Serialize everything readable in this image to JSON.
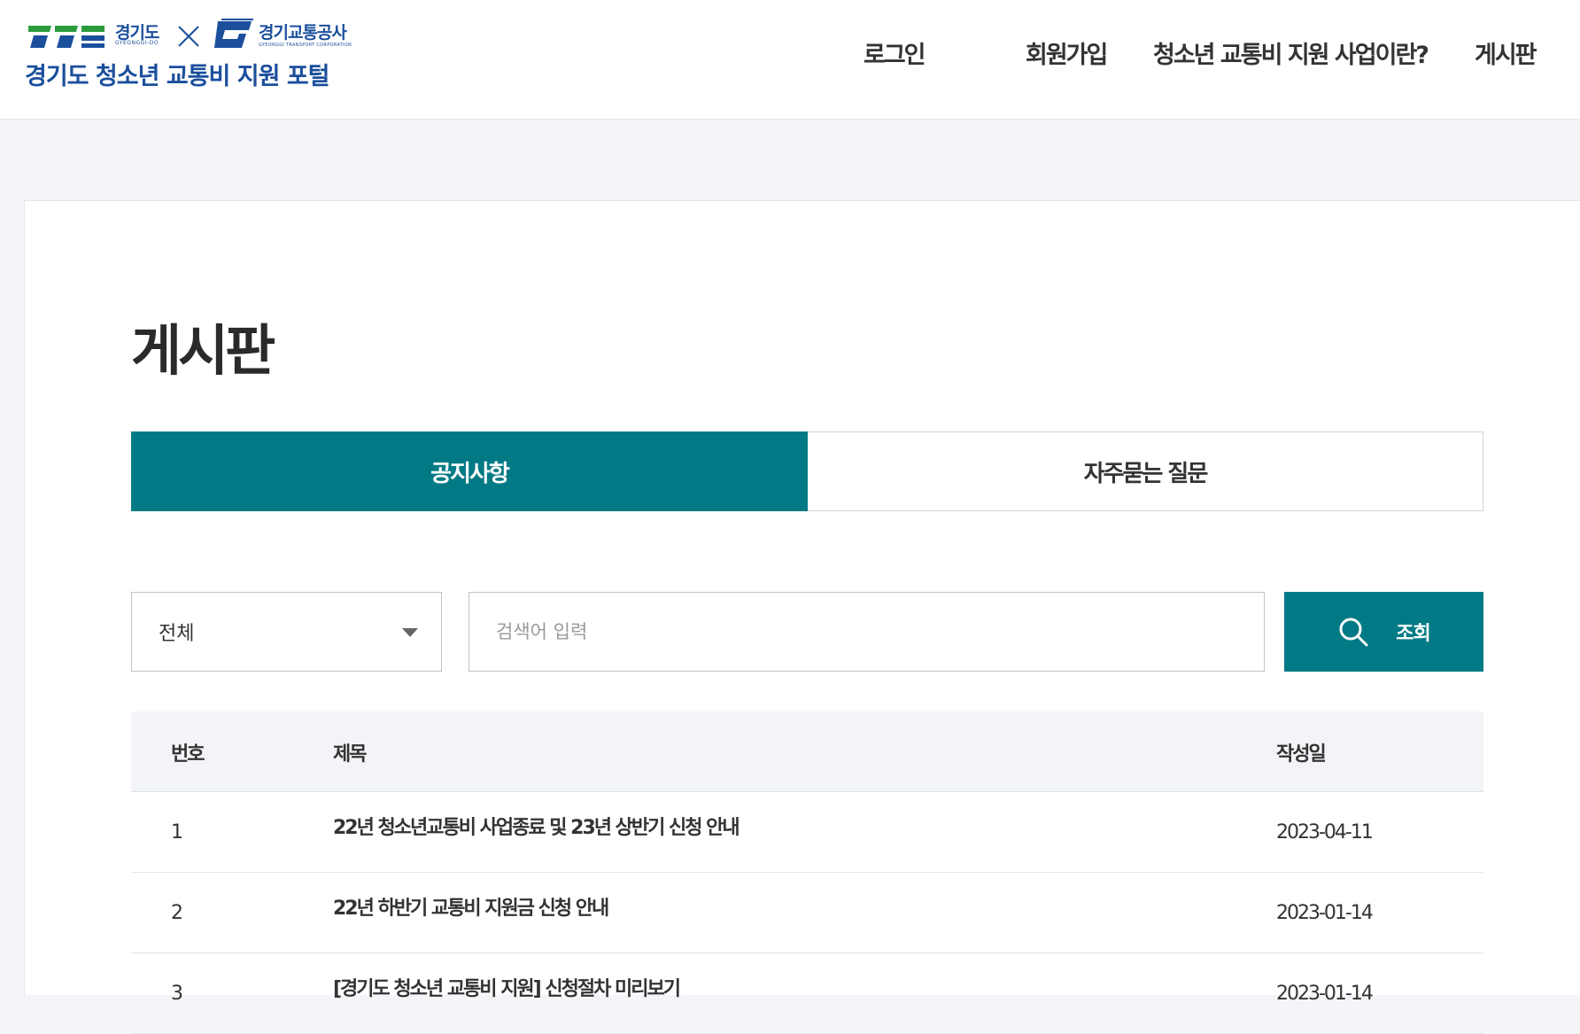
{
  "header": {
    "logo": {
      "gyeonggi_text": "경기도",
      "gyeonggi_sub": "GYEONGGI-DO",
      "gtc_text": "경기교통공사",
      "gtc_sub": "GYEONGGI TRANSPORT CORPORATION",
      "portal_title": "경기도 청소년 교통비 지원 포털"
    },
    "nav": [
      {
        "label": "로그인"
      },
      {
        "label": "회원가입"
      },
      {
        "label": "청소년 교통비 지원 사업이란?"
      },
      {
        "label": "게시판"
      }
    ]
  },
  "page": {
    "title": "게시판",
    "tabs": [
      {
        "label": "공지사항",
        "active": true
      },
      {
        "label": "자주묻는 질문",
        "active": false
      }
    ],
    "search": {
      "category_value": "전체",
      "placeholder": "검색어 입력",
      "button_label": "조회"
    },
    "table": {
      "headers": {
        "no": "번호",
        "title": "제목",
        "date": "작성일"
      },
      "rows": [
        {
          "no": "1",
          "title": "22년 청소년교통비 사업종료 및 23년 상반기 신청 안내",
          "date": "2023-04-11"
        },
        {
          "no": "2",
          "title": "22년 하반기 교통비 지원금 신청 안내",
          "date": "2023-01-14"
        },
        {
          "no": "3",
          "title": "[경기도 청소년 교통비 지원] 신청절차 미리보기",
          "date": "2023-01-14"
        }
      ]
    }
  },
  "colors": {
    "accent": "#017a85",
    "brand_blue": "#1b4f9c",
    "brand_green": "#2c9b3e"
  },
  "icons": {
    "search": "search-icon",
    "dropdown": "caret-down-icon",
    "cross": "times-icon"
  }
}
